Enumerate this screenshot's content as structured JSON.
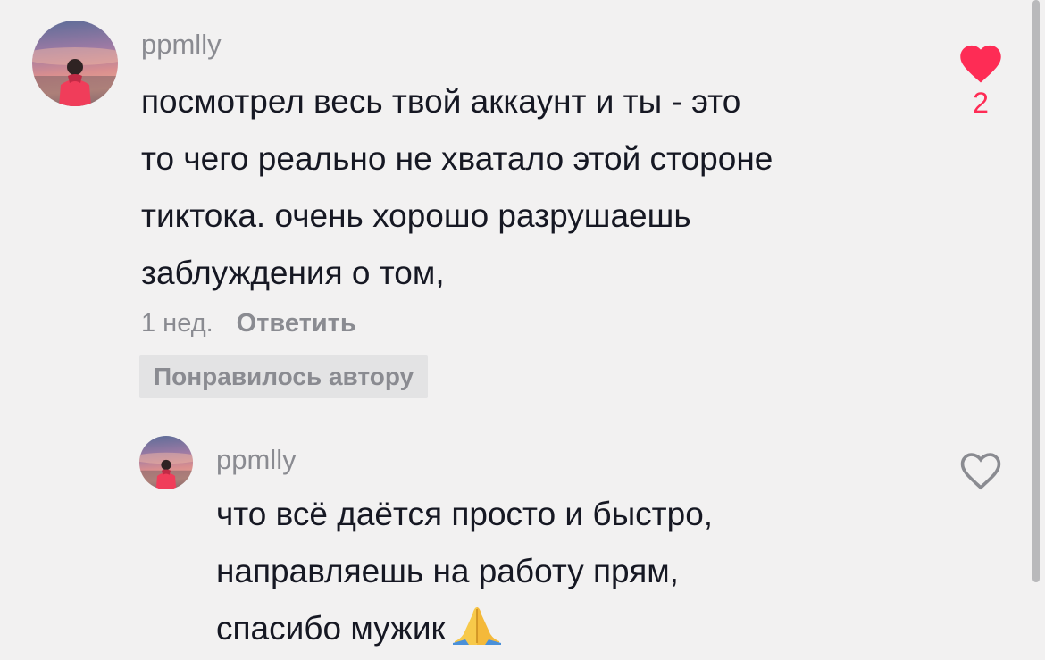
{
  "colors": {
    "background": "#f2f1f1",
    "text": "#161823",
    "muted": "#8a8b91",
    "like": "#fe2c55",
    "badge_bg": "#e3e3e4"
  },
  "comment": {
    "username": "ppmlly",
    "text_lines": [
      "посмотрел весь твой аккаунт и ты - это",
      "то чего реально не хватало этой стороне",
      "тиктока. очень хорошо разрушаешь",
      "заблуждения о том,"
    ],
    "time": "1 нед.",
    "reply_label": "Ответить",
    "creator_badge": "Понравилось автору",
    "like_count": "2",
    "liked": true,
    "like_icon": "heart-filled-icon"
  },
  "reply": {
    "username": "ppmlly",
    "text_lines": [
      "что всё даётся просто и быстро,",
      "направляешь на работу прям,",
      "спасибо мужик"
    ],
    "emoji": "folded-hands-emoji",
    "liked": false,
    "like_icon": "heart-outline-icon"
  }
}
